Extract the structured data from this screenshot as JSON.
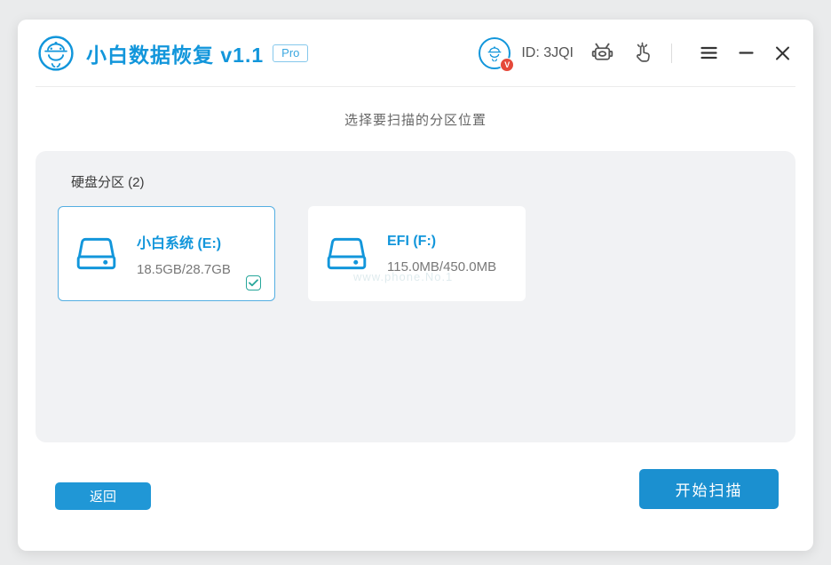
{
  "window": {
    "title": "小白数据恢复 v1.1",
    "badge": "Pro"
  },
  "titlebar": {
    "user_id": "ID: 3JQI",
    "icons": {
      "logo": "mascot-logo-icon",
      "avatar": "user-avatar-with-v-badge",
      "robot": "robot-icon",
      "hand": "hand-click-icon",
      "menu": "hamburger-menu-icon",
      "minimize": "minimize-icon",
      "close": "close-icon"
    }
  },
  "main": {
    "heading": "选择要扫描的分区位置",
    "panel": {
      "label": "硬盘分区 (2)",
      "partitions": [
        {
          "name": "小白系统 (E:)",
          "size": "18.5GB/28.7GB",
          "selected": true
        },
        {
          "name": "EFI (F:)",
          "size": "115.0MB/450.0MB",
          "selected": false
        }
      ]
    },
    "watermark": "www.phone.No.1"
  },
  "footer": {
    "back_label": "返回",
    "scan_label": "开始扫描"
  },
  "colors": {
    "brand_blue": "#1296db",
    "button_blue": "#1e97d4",
    "selected_border": "#54aee2",
    "checkbox_teal": "#26a69a",
    "panel_bg": "#f1f2f4",
    "page_bg": "#eaebec",
    "badge_red": "#e5493a"
  }
}
